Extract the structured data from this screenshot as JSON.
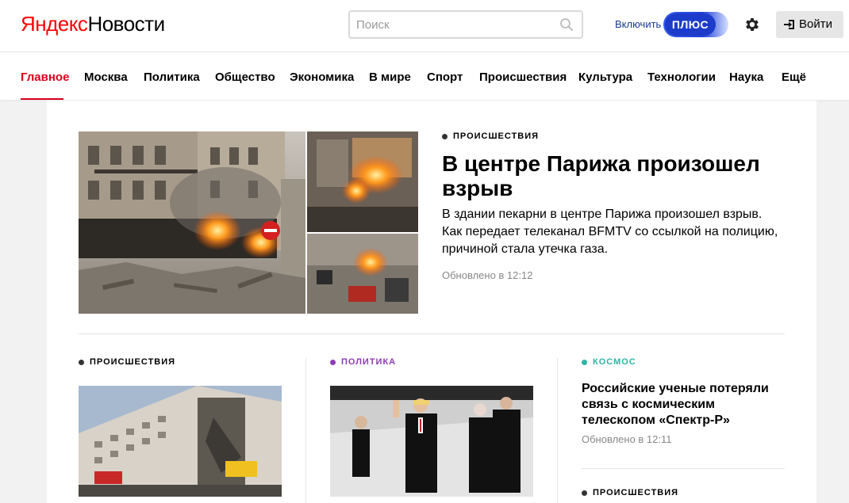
{
  "header": {
    "logo_yandex": "Яндекс",
    "logo_news": "Новости",
    "search_placeholder": "Поиск",
    "search_value": "",
    "plus_enable_label": "Включить",
    "plus_label": "ПЛЮС",
    "login_label": "Войти",
    "icons": {
      "search": "search-icon",
      "settings": "gear-icon",
      "login": "login-icon"
    }
  },
  "nav": {
    "items": [
      "Главное",
      "Москва",
      "Политика",
      "Общество",
      "Экономика",
      "В мире",
      "Спорт",
      "Происшествия",
      "Культура",
      "Технологии",
      "Наука",
      "Ещё"
    ],
    "active": "Главное"
  },
  "hero": {
    "rubric": "ПРОИСШЕСТВИЯ",
    "title": "В центре Парижа произошел взрыв",
    "lead": "В здании пекарни в центре Парижа произошел взрыв. Как передает телеканал BFMTV со ссылкой на полицию, причиной стала утечка газа.",
    "updated": "Обновлено в 12:12"
  },
  "columns": [
    {
      "rubric": "ПРОИСШЕСТВИЯ"
    },
    {
      "rubric": "ПОЛИТИКА"
    },
    {
      "rubric": "КОСМОС",
      "title": "Российские ученые потеряли связь с космическим телескопом «Спектр-Р»",
      "updated": "Обновлено в 12:11"
    },
    {
      "rubric": "ПРОИСШЕСТВИЯ"
    }
  ],
  "colors": {
    "brand_red": "#ff0000",
    "nav_active": "#d9001b",
    "plus_blue": "#1c3cc9",
    "rubric_incidents": "#333333",
    "rubric_politics": "#8e3cb4",
    "rubric_space": "#2eb5a6"
  }
}
